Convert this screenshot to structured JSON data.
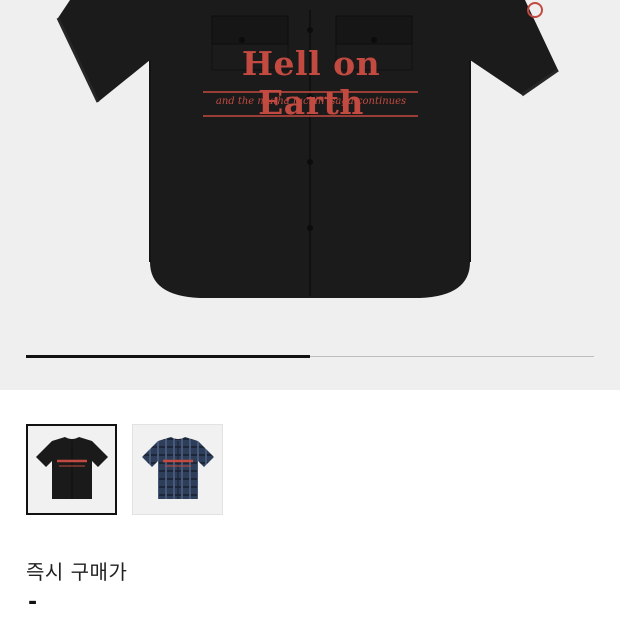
{
  "product": {
    "graphic_title": "Hell on Earth",
    "graphic_subtitle": "and the mutha fuckin' saga continues",
    "image_progress_fraction": 0.5
  },
  "thumbnails": [
    {
      "name": "thumbnail-black-shirt",
      "selected": true,
      "color": "#1a1a1a"
    },
    {
      "name": "thumbnail-plaid-shirt",
      "selected": false,
      "color": "#2f3e58"
    }
  ],
  "price": {
    "label": "즉시 구매가",
    "value": "-"
  },
  "colors": {
    "graphic_red": "#c24a40",
    "shirt_black": "#1b1b1b",
    "background_gray": "#efefef"
  }
}
